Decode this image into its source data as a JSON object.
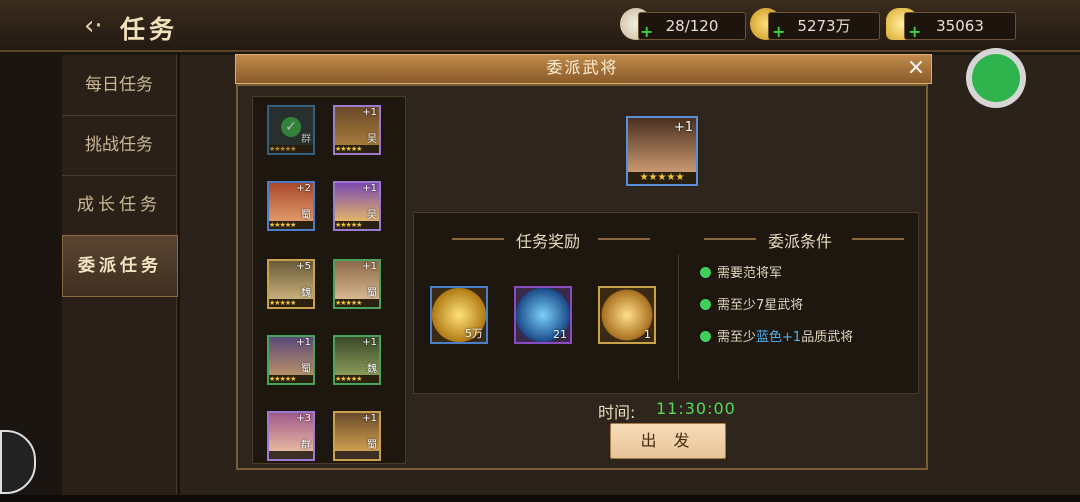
{
  "header": {
    "back_icon": "chevron-left-icon",
    "title": "任务"
  },
  "resources": [
    {
      "icon": "bun-icon",
      "value": "28/120",
      "plus": "+"
    },
    {
      "icon": "gold-coin-icon",
      "value": "5273万",
      "plus": "+"
    },
    {
      "icon": "gold-ingot-icon",
      "value": "35063",
      "plus": "+"
    }
  ],
  "nav": [
    {
      "label": "每日任务",
      "active": false
    },
    {
      "label": "挑战任务",
      "active": false
    },
    {
      "label": "成长任务",
      "active": false
    },
    {
      "label": "委派任务",
      "active": true
    }
  ],
  "dialog": {
    "title": "委派武将",
    "close": "×"
  },
  "heroes": [
    {
      "level": "",
      "kingdom": "群",
      "selected": true
    },
    {
      "level": "+1",
      "kingdom": "吴"
    },
    {
      "level": "+2",
      "kingdom": "蜀"
    },
    {
      "level": "+1",
      "kingdom": "吴"
    },
    {
      "level": "+5",
      "kingdom": "魏"
    },
    {
      "level": "+1",
      "kingdom": "蜀"
    },
    {
      "level": "+1",
      "kingdom": "蜀"
    },
    {
      "level": "+1",
      "kingdom": "魏"
    },
    {
      "level": "+3",
      "kingdom": "群"
    },
    {
      "level": "+1",
      "kingdom": "蜀"
    }
  ],
  "selected_hero": {
    "level": "+1",
    "stars": "★★★★★"
  },
  "rewards": {
    "title": "任务奖励",
    "items": [
      {
        "icon": "gold-coin-icon",
        "count": "5万"
      },
      {
        "icon": "blue-gem-icon",
        "count": "21"
      },
      {
        "icon": "treasure-chest-icon",
        "count": "1"
      }
    ]
  },
  "conditions": {
    "title": "委派条件",
    "items": [
      {
        "text": "需要范将军"
      },
      {
        "text": "需至少7星武将"
      },
      {
        "pre": "需至少",
        "highlight": "蓝色+1",
        "post": "品质武将"
      }
    ]
  },
  "timer": {
    "label": "时间:",
    "value": "11:30:00"
  },
  "go_button": "出 发",
  "colors": {
    "accent": "#c08a4a",
    "timer": "#58d858",
    "highlight": "#4fb0ee"
  }
}
